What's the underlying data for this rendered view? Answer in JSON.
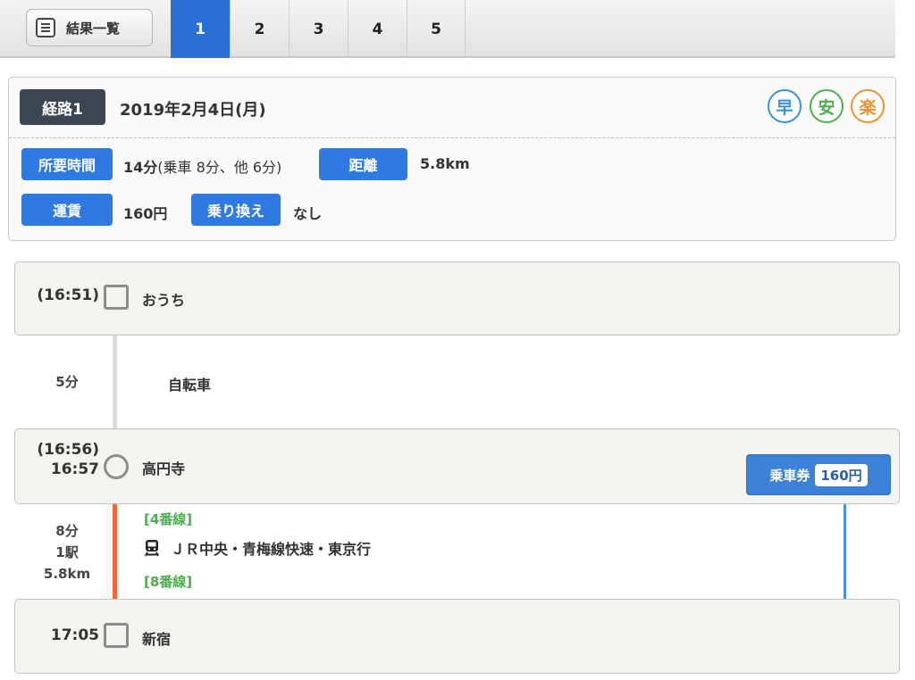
{
  "tabs": {
    "list_label": "結果一覧",
    "items": [
      "1",
      "2",
      "3",
      "4",
      "5"
    ],
    "active": "1"
  },
  "summary": {
    "route_label": "経路1",
    "date": "2019年2月4日(月)",
    "badges": [
      {
        "label": "早",
        "color": "#3a8fe0"
      },
      {
        "label": "安",
        "color": "#4cae4c"
      },
      {
        "label": "楽",
        "color": "#f0912e"
      }
    ],
    "time_tag": "所要時間",
    "time_value": "14分",
    "time_detail": "(乗車 8分、他 6分)",
    "distance_tag": "距離",
    "distance_value": "5.8km",
    "fare_tag": "運賃",
    "fare_value": "160円",
    "transfer_tag": "乗り換え",
    "transfer_value": "なし"
  },
  "timeline": {
    "stop1": {
      "time": "(16:51)",
      "name": "おうち"
    },
    "seg1": {
      "duration": "5分",
      "mode": "自転車"
    },
    "stop2": {
      "arrive": "(16:56)",
      "depart": "16:57",
      "name": "高円寺"
    },
    "ticket": {
      "label": "乗車券",
      "price": "160円"
    },
    "seg2": {
      "duration": "8分",
      "stations": "1駅",
      "distance": "5.8km",
      "from_track": "[4番線]",
      "train": "ＪＲ中央・青梅線快速・東京行",
      "to_track": "[8番線]"
    },
    "stop3": {
      "time": "17:05",
      "name": "新宿"
    }
  }
}
